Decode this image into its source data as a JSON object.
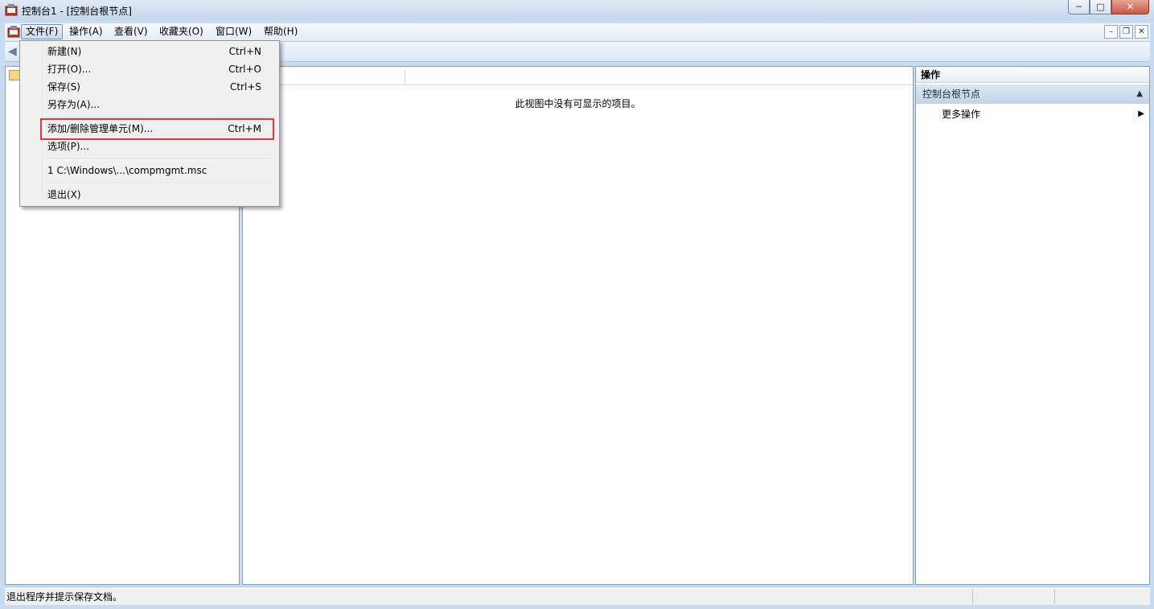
{
  "window": {
    "title": "控制台1 - [控制台根节点]",
    "minimize_glyph": "─",
    "maximize_glyph": "□",
    "close_glyph": "✕"
  },
  "menubar": {
    "items": [
      "文件(F)",
      "操作(A)",
      "查看(V)",
      "收藏夹(O)",
      "窗口(W)",
      "帮助(H)"
    ],
    "mdi_min": "–",
    "mdi_restore": "❐",
    "mdi_close": "✕"
  },
  "file_menu": {
    "items": [
      {
        "label": "新建(N)",
        "shortcut": "Ctrl+N"
      },
      {
        "label": "打开(O)...",
        "shortcut": "Ctrl+O"
      },
      {
        "label": "保存(S)",
        "shortcut": "Ctrl+S"
      },
      {
        "label": "另存为(A)...",
        "shortcut": ""
      },
      {
        "label": "添加/删除管理单元(M)...",
        "shortcut": "Ctrl+M"
      },
      {
        "label": "选项(P)...",
        "shortcut": ""
      },
      {
        "label": "1 C:\\Windows\\...\\compmgmt.msc",
        "shortcut": ""
      },
      {
        "label": "退出(X)",
        "shortcut": ""
      }
    ]
  },
  "center": {
    "empty_message": "此视图中没有可显示的项目。"
  },
  "actions": {
    "header": "操作",
    "section": "控制台根节点",
    "more": "更多操作",
    "collapse_glyph": "▲",
    "more_glyph": "▶"
  },
  "statusbar": {
    "text": "退出程序并提示保存文档。"
  },
  "colors": {
    "highlight": "#e0383b",
    "title_bg": "#c4d7ec",
    "close_btn": "#c65a45"
  }
}
